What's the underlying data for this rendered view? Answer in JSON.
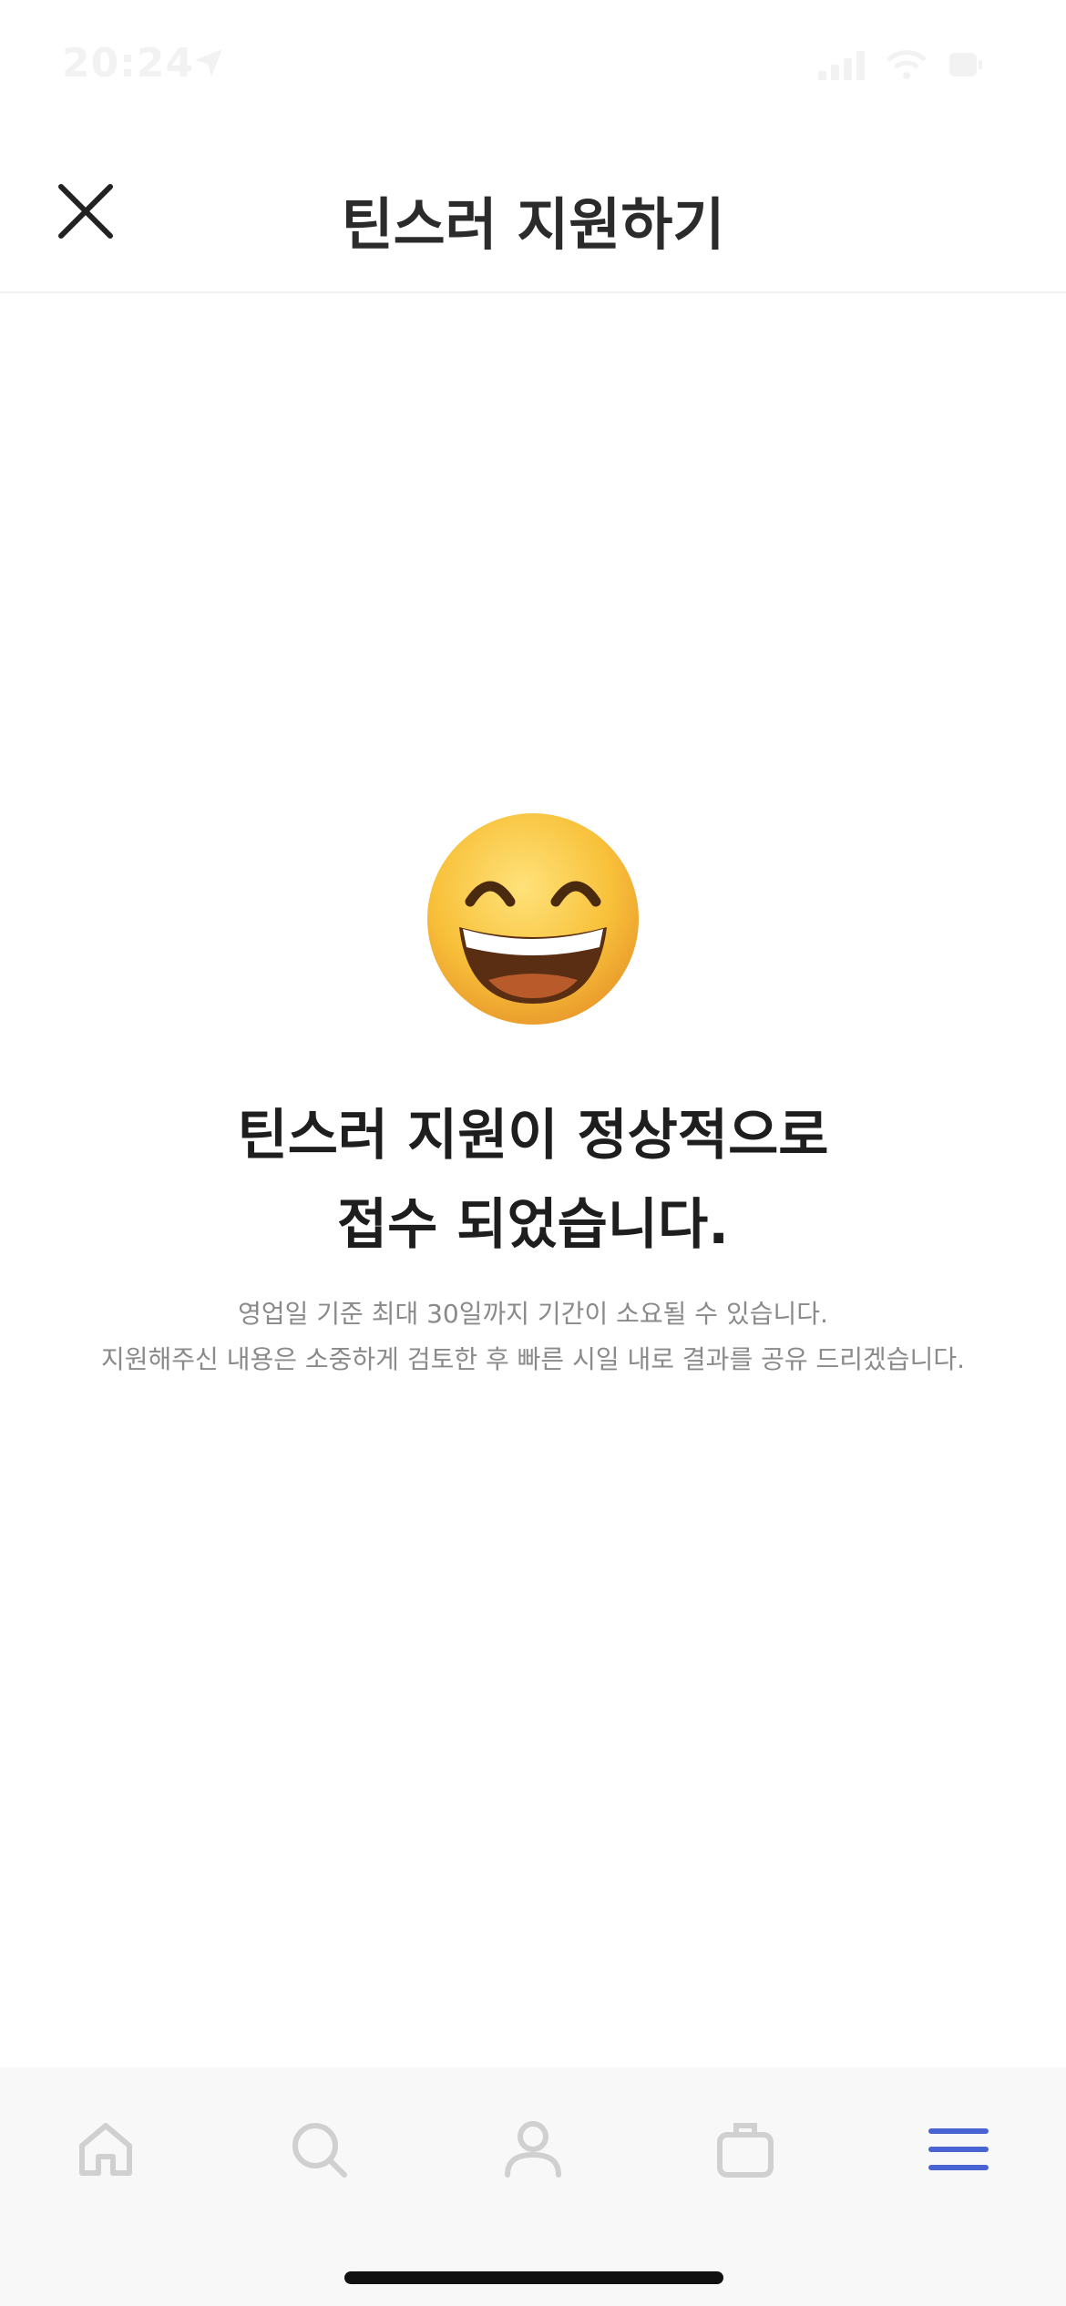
{
  "status_bar": {
    "time": "20:24"
  },
  "header": {
    "title": "틴스러 지원하기",
    "close_icon": "close-icon"
  },
  "main": {
    "emoji": "grinning-face-with-smiling-eyes",
    "title_line1": "틴스러 지원이 정상적으로",
    "title_line2": "접수 되었습니다.",
    "subtitle_line1": "영업일 기준 최대 30일까지 기간이 소요될 수 있습니다.",
    "subtitle_line2": "지원해주신 내용은 소중하게 검토한 후 빠른 시일 내로 결과를 공유 드리겠습니다."
  },
  "tabbar": {
    "items": [
      {
        "icon": "home-icon",
        "active": false
      },
      {
        "icon": "search-icon",
        "active": false
      },
      {
        "icon": "profile-icon",
        "active": false
      },
      {
        "icon": "briefcase-icon",
        "active": false
      },
      {
        "icon": "menu-icon",
        "active": true
      }
    ],
    "inactive_color": "#d0d0d0",
    "active_color": "#4a63d3"
  }
}
